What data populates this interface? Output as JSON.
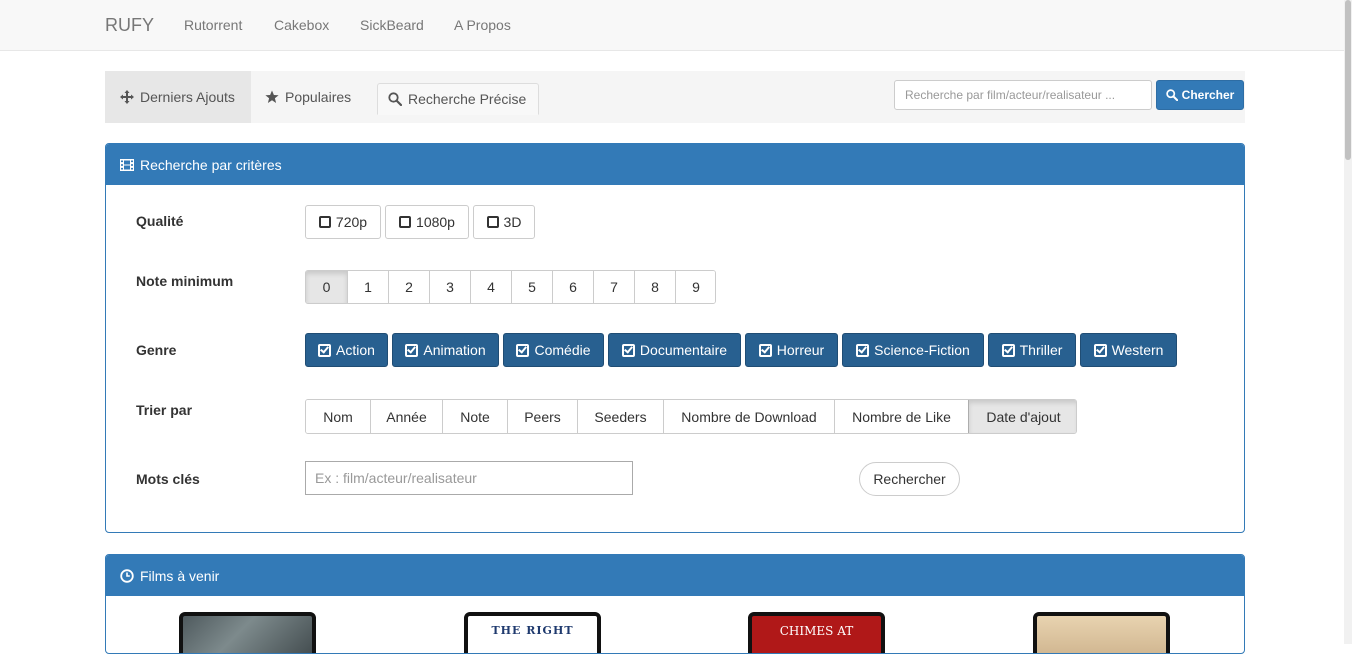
{
  "navbar": {
    "brand": "RUFY",
    "links": [
      "Rutorrent",
      "Cakebox",
      "SickBeard",
      "A Propos"
    ]
  },
  "tabs": {
    "derniers": "Derniers Ajouts",
    "populaires": "Populaires",
    "recherche": "Recherche Précise",
    "active": "derniers"
  },
  "search": {
    "placeholder": "Recherche par film/acteur/realisateur ...",
    "button": "Chercher"
  },
  "criteria": {
    "title": "Recherche par critères",
    "qualite": {
      "label": "Qualité",
      "options": [
        "720p",
        "1080p",
        "3D"
      ]
    },
    "note": {
      "label": "Note minimum",
      "options": [
        "0",
        "1",
        "2",
        "3",
        "4",
        "5",
        "6",
        "7",
        "8",
        "9"
      ],
      "selected": "0"
    },
    "genre": {
      "label": "Genre",
      "options": [
        "Action",
        "Animation",
        "Comédie",
        "Documentaire",
        "Horreur",
        "Science-Fiction",
        "Thriller",
        "Western"
      ]
    },
    "trier": {
      "label": "Trier par",
      "options": [
        "Nom",
        "Année",
        "Note",
        "Peers",
        "Seeders",
        "Nombre de Download",
        "Nombre de Like",
        "Date d'ajout"
      ],
      "selected": "Date d'ajout"
    },
    "mots": {
      "label": "Mots clés",
      "placeholder": "Ex : film/acteur/realisateur",
      "button": "Rechercher"
    }
  },
  "films": {
    "title": "Films à venir",
    "posters": [
      {
        "text": ""
      },
      {
        "text": "THE RIGHT"
      },
      {
        "text": "CHIMES AT"
      },
      {
        "text": ""
      }
    ]
  },
  "colors": {
    "primary": "#337ab7",
    "genre_button": "#286090",
    "navbar_bg": "#f8f8f8"
  }
}
